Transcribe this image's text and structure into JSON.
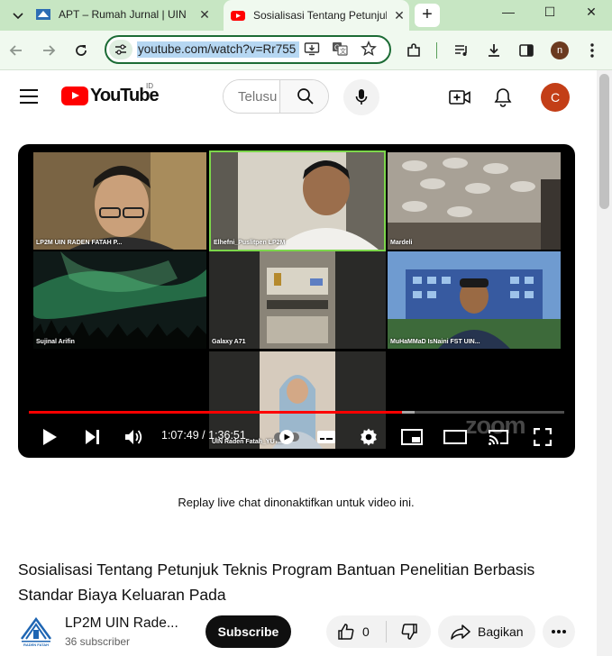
{
  "browser": {
    "tabs": [
      {
        "title": "APT – Rumah Jurnal | UIN",
        "active": false,
        "favicon": "apt-logo-icon"
      },
      {
        "title": "Sosialisasi Tentang Petunjuk",
        "active": true,
        "favicon": "youtube-icon"
      }
    ],
    "new_tab_label": "+",
    "window_controls": {
      "minimize": "—",
      "maximize": "☐",
      "close": "✕"
    },
    "url": "youtube.com/watch?v=Rr755",
    "profile_initial": "n"
  },
  "youtube": {
    "logo_text": "YouTube",
    "country_code": "ID",
    "search_placeholder": "Telusuri",
    "avatar_initial": "C",
    "player": {
      "participants": [
        {
          "name": "LP2M UIN RADEN FATAH P...",
          "bg": "#6f5a3c",
          "speaking": false
        },
        {
          "name": "Elhefni_Puslitpen LP2M",
          "bg": "#c9c4b8",
          "speaking": true
        },
        {
          "name": "Mardeli",
          "bg": "#9b9386",
          "speaking": false
        },
        {
          "name": "Sujinal Arifin",
          "bg": "#16261e",
          "speaking": false
        },
        {
          "name": "Galaxy A71",
          "bg": "#6a6a62",
          "speaking": false
        },
        {
          "name": "MuHaMMaD IsNaini FST UIN...",
          "bg": "#4d6f98",
          "speaking": false
        },
        {
          "name": "UIN Raden Fatah_YUT...",
          "bg": "#cdbfb0",
          "speaking": false
        }
      ],
      "current_time": "1:07:49",
      "duration": "1:36:51",
      "time_text": "1:07:49 / 1:36:51",
      "progress_fraction": 0.6967,
      "buffered_fraction": 0.72,
      "progress_color": "#ff0000",
      "watermark": "zoom"
    },
    "chat_note": "Replay live chat dinonaktifkan untuk video ini.",
    "video_title": "Sosialisasi Tentang Petunjuk Teknis Program Bantuan Penelitian Berbasis Standar Biaya Keluaran Pada",
    "channel": {
      "name": "LP2M UIN Rade...",
      "subscribers": "36 subscriber",
      "logo_caption": "RADEN FATAH"
    },
    "subscribe_label": "Subscribe",
    "like_count": "0",
    "share_label": "Bagikan"
  }
}
